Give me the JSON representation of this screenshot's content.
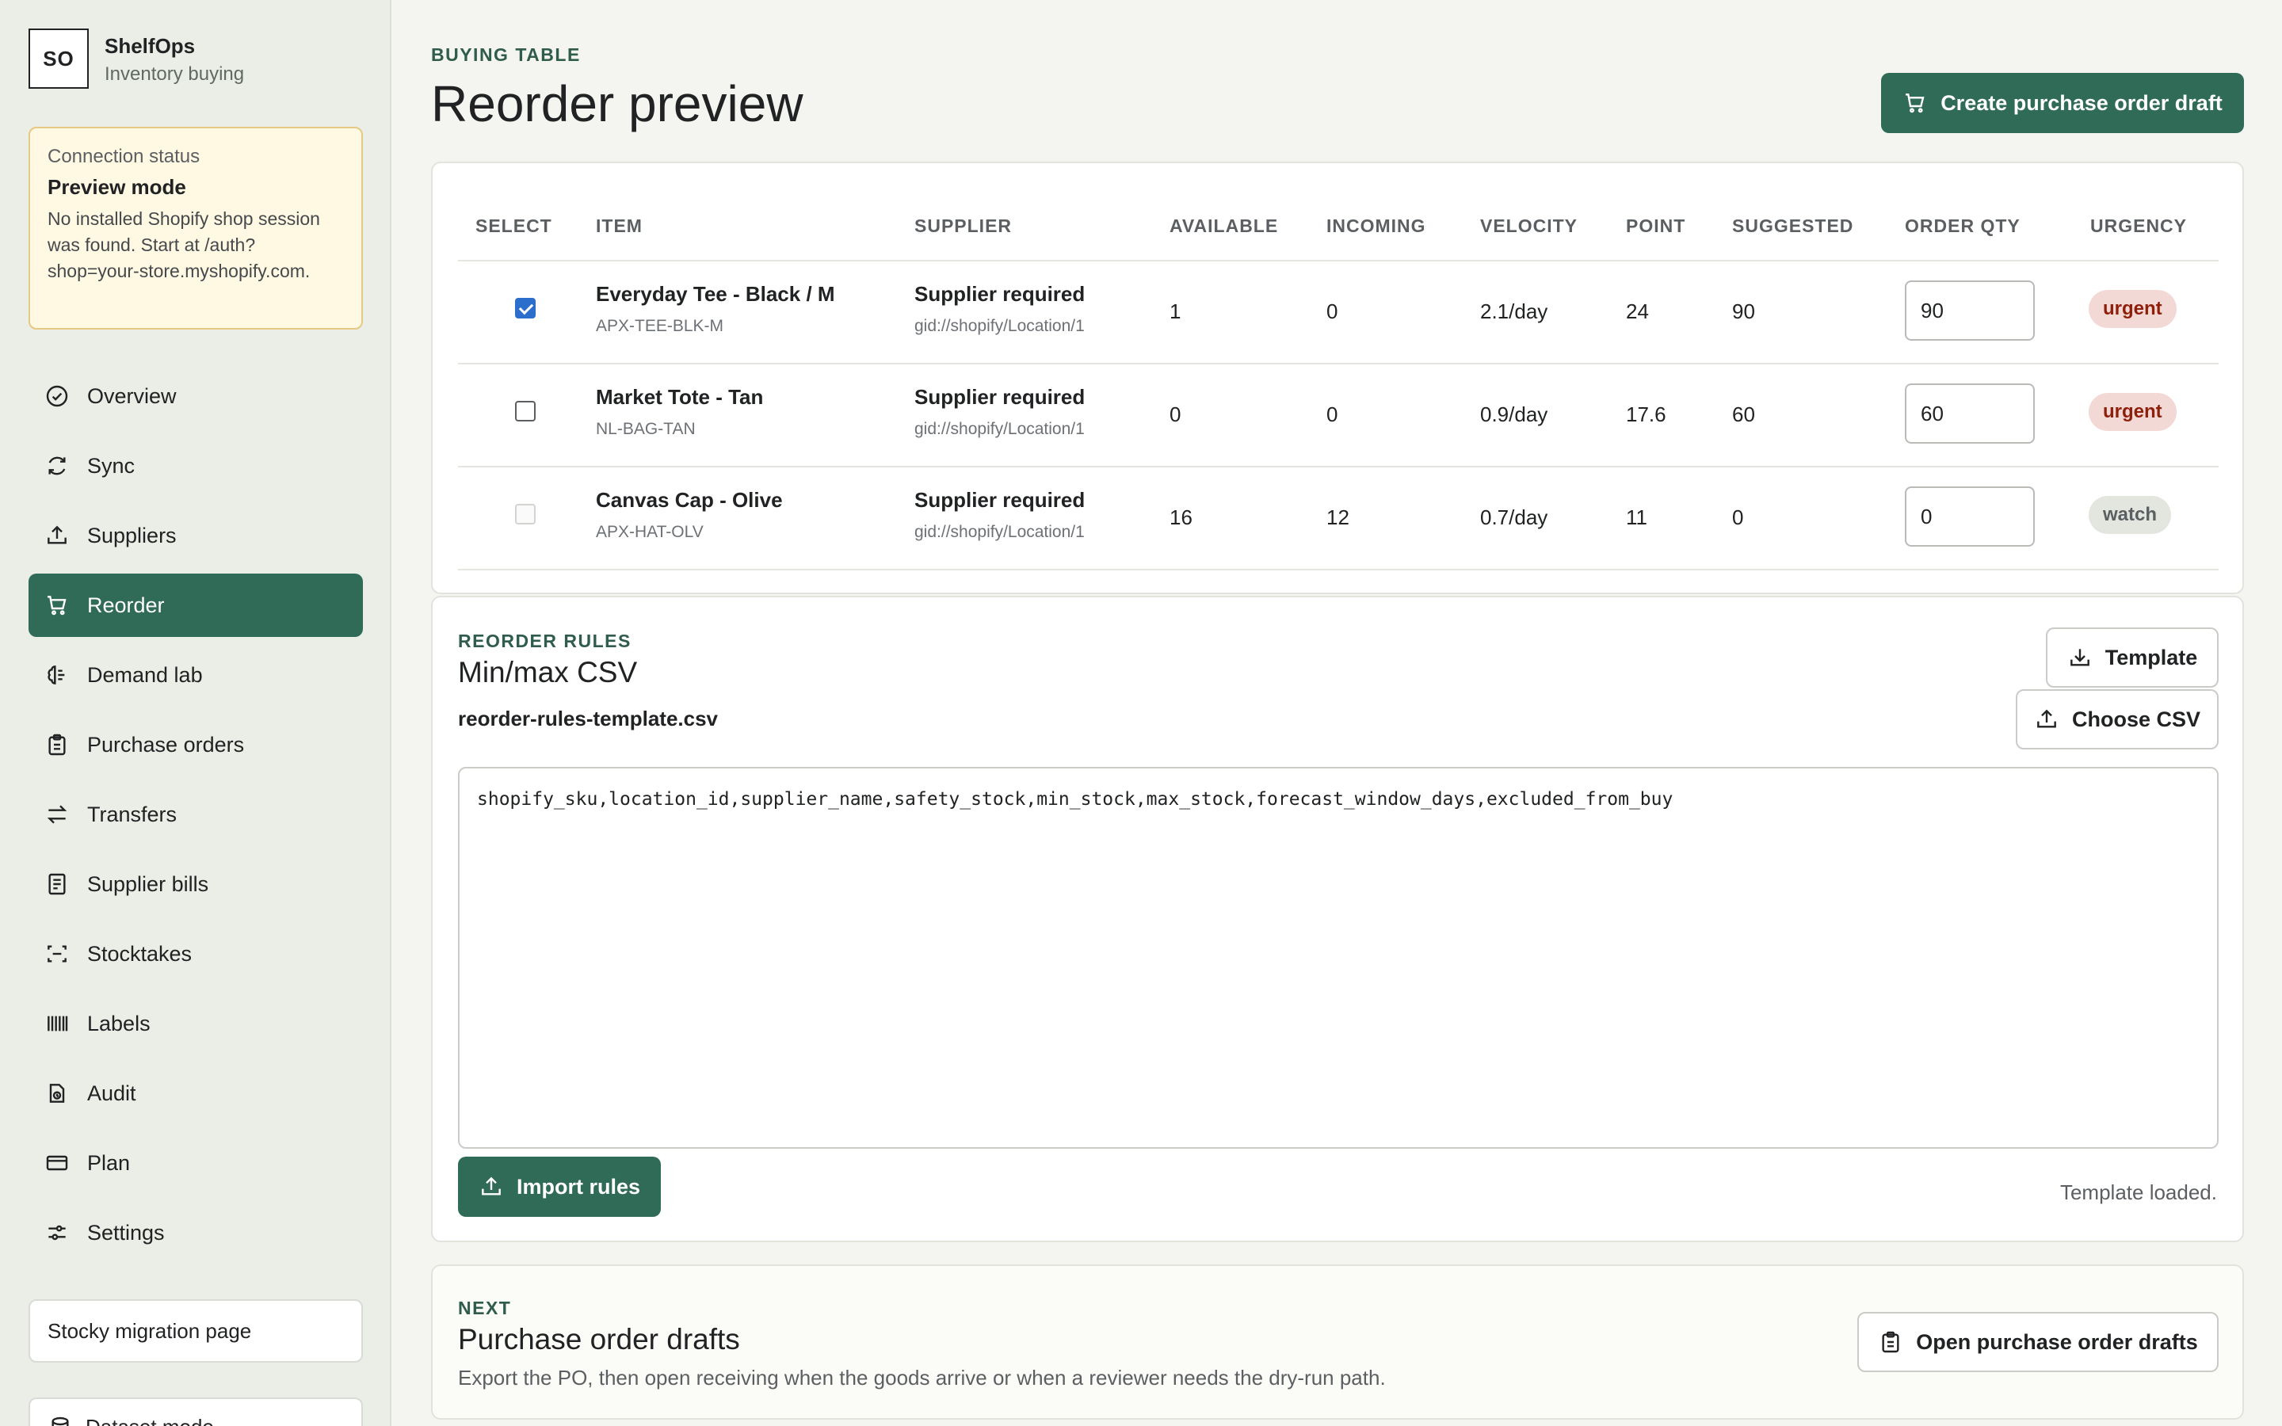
{
  "brand": {
    "initials": "SO",
    "name": "ShelfOps",
    "subtitle": "Inventory buying"
  },
  "connection": {
    "label": "Connection status",
    "title": "Preview mode",
    "message": "No installed Shopify shop session was found. Start at /auth?shop=your-store.myshopify.com."
  },
  "nav": {
    "items": [
      {
        "label": "Overview",
        "icon": "check-circle-icon",
        "active": false
      },
      {
        "label": "Sync",
        "icon": "refresh-icon",
        "active": false
      },
      {
        "label": "Suppliers",
        "icon": "upload-icon",
        "active": false
      },
      {
        "label": "Reorder",
        "icon": "cart-icon",
        "active": true
      },
      {
        "label": "Demand lab",
        "icon": "brain-icon",
        "active": false
      },
      {
        "label": "Purchase orders",
        "icon": "clipboard-icon",
        "active": false
      },
      {
        "label": "Transfers",
        "icon": "arrows-icon",
        "active": false
      },
      {
        "label": "Supplier bills",
        "icon": "receipt-icon",
        "active": false
      },
      {
        "label": "Stocktakes",
        "icon": "scan-icon",
        "active": false
      },
      {
        "label": "Labels",
        "icon": "barcode-icon",
        "active": false
      },
      {
        "label": "Audit",
        "icon": "audit-icon",
        "active": false
      },
      {
        "label": "Plan",
        "icon": "card-icon",
        "active": false
      },
      {
        "label": "Settings",
        "icon": "sliders-icon",
        "active": false
      }
    ],
    "migration_label": "Stocky migration page",
    "partial_label": "Dataset mode"
  },
  "header": {
    "eyebrow": "BUYING TABLE",
    "title": "Reorder preview",
    "create_button": "Create purchase order draft"
  },
  "table": {
    "columns": {
      "select": "SELECT",
      "item": "ITEM",
      "supplier": "SUPPLIER",
      "available": "AVAILABLE",
      "incoming": "INCOMING",
      "velocity": "VELOCITY",
      "point": "POINT",
      "suggested": "SUGGESTED",
      "order_qty": "ORDER QTY",
      "urgency": "URGENCY"
    },
    "rows": [
      {
        "selected": true,
        "disabled": false,
        "name": "Everyday Tee - Black / M",
        "sku": "APX-TEE-BLK-M",
        "supplier": "Supplier required",
        "location": "gid://shopify/Location/1",
        "available": "1",
        "incoming": "0",
        "velocity": "2.1/day",
        "point": "24",
        "suggested": "90",
        "order_qty": "90",
        "urgency": "urgent"
      },
      {
        "selected": false,
        "disabled": false,
        "name": "Market Tote - Tan",
        "sku": "NL-BAG-TAN",
        "supplier": "Supplier required",
        "location": "gid://shopify/Location/1",
        "available": "0",
        "incoming": "0",
        "velocity": "0.9/day",
        "point": "17.6",
        "suggested": "60",
        "order_qty": "60",
        "urgency": "urgent"
      },
      {
        "selected": false,
        "disabled": true,
        "name": "Canvas Cap - Olive",
        "sku": "APX-HAT-OLV",
        "supplier": "Supplier required",
        "location": "gid://shopify/Location/1",
        "available": "16",
        "incoming": "12",
        "velocity": "0.7/day",
        "point": "11",
        "suggested": "0",
        "order_qty": "0",
        "urgency": "watch"
      }
    ]
  },
  "rules": {
    "eyebrow": "REORDER RULES",
    "title": "Min/max CSV",
    "filename": "reorder-rules-template.csv",
    "template_button": "Template",
    "choose_button": "Choose CSV",
    "csv_text": "shopify_sku,location_id,supplier_name,safety_stock,min_stock,max_stock,forecast_window_days,excluded_from_buy",
    "import_button": "Import rules",
    "status": "Template loaded."
  },
  "next": {
    "eyebrow": "NEXT",
    "title": "Purchase order drafts",
    "description": "Export the PO, then open receiving when the goods arrive or when a reviewer needs the dry-run path.",
    "button": "Open purchase order drafts"
  },
  "colors": {
    "accent": "#2f6b57",
    "urgent_bg": "#f3d9d6",
    "urgent_text": "#8e1f0b",
    "notice_bg": "#fff8e3"
  }
}
